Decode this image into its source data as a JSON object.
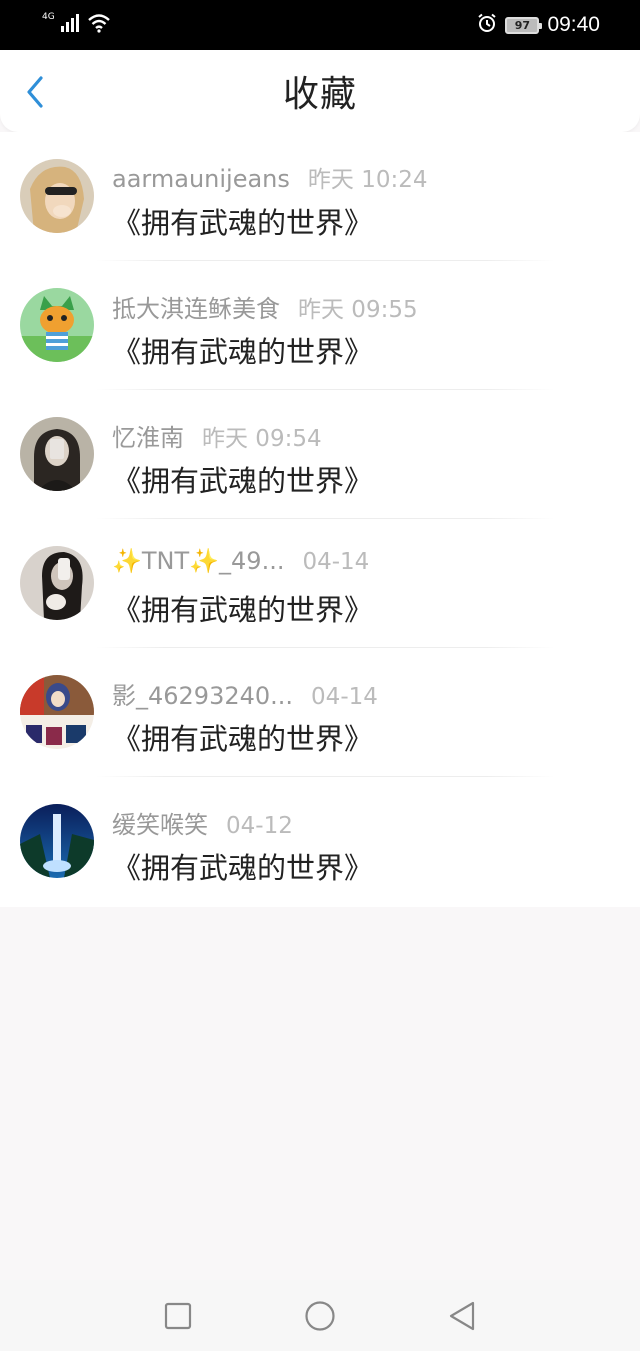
{
  "status_bar": {
    "network": "4G",
    "battery": "97",
    "time": "09:40"
  },
  "header": {
    "title": "收藏",
    "back_icon": "chevron-left-icon",
    "accent_color": "#2f8fd8"
  },
  "favorites": [
    {
      "user": "aarmaunijeans",
      "time": "昨天 10:24",
      "book": "《拥有武魂的世界》"
    },
    {
      "user": "抵大淇连稣美食",
      "time": "昨天 09:55",
      "book": "《拥有武魂的世界》"
    },
    {
      "user": "忆淮南",
      "time": "昨天 09:54",
      "book": "《拥有武魂的世界》"
    },
    {
      "user": "✨TNT✨_49...",
      "time": "04-14",
      "book": "《拥有武魂的世界》"
    },
    {
      "user": "影_46293240...",
      "time": "04-14",
      "book": "《拥有武魂的世界》"
    },
    {
      "user": "缓笑喉笑",
      "time": "04-12",
      "book": "《拥有武魂的世界》"
    }
  ],
  "nav_bar": {
    "recent_icon": "square-icon",
    "home_icon": "circle-icon",
    "back_icon": "triangle-back-icon"
  }
}
